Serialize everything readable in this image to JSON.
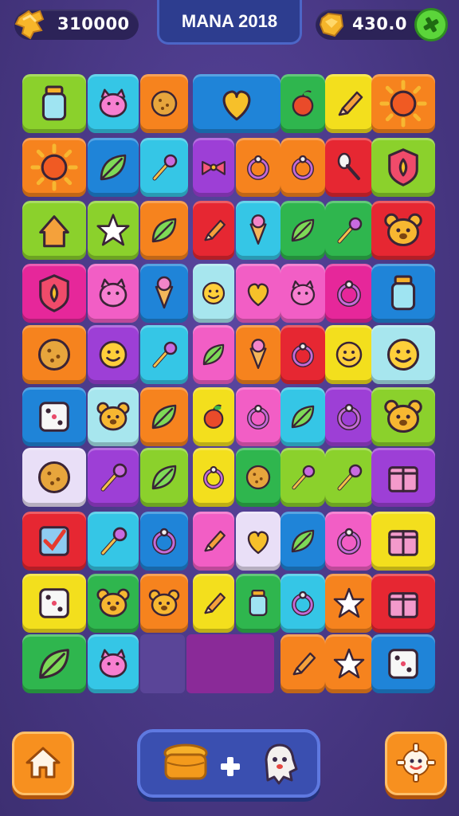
{
  "header": {
    "coins": "310000",
    "title": "MANA 2018",
    "gems": "430.0"
  },
  "icons": {
    "coins": "coin-stack-icon",
    "gems": "gem-icon",
    "add": "plus-icon",
    "home": "home-icon",
    "settings": "gear-icon",
    "booster_honey": "honey-pot-icon",
    "booster_plus": "plus-icon",
    "booster_character": "ghost-character-icon"
  },
  "board": {
    "rows": 10,
    "columns": 7,
    "note_colors": [
      "#8bd12c",
      "#35c6e6",
      "#f6831e",
      "#1f84d8",
      "#f3df1d",
      "#e6279a",
      "#9d3fd6",
      "#e62732",
      "#2fb64e",
      "#f25ec5"
    ]
  },
  "colors": {
    "background": "#4d3b86",
    "button_orange": "#f7901f",
    "panel_blue": "#3a4fb0",
    "add_green": "#5bd53a"
  }
}
